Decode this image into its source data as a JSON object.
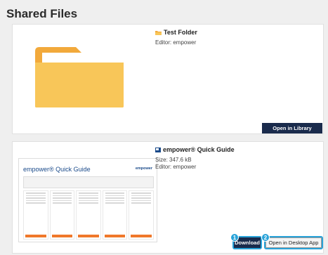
{
  "page": {
    "title": "Shared Files"
  },
  "items": [
    {
      "icon": "folder-icon",
      "name": "Test Folder",
      "editor": "Editor: empower",
      "button": "Open in Library"
    },
    {
      "icon": "presentation-icon",
      "name": "empower® Quick Guide",
      "size": "Size: 347.6 kB",
      "editor": "Editor: empower",
      "buttons": {
        "download": "Download",
        "open_desktop": "Open in Desktop App"
      },
      "badges": {
        "download": "1",
        "open_desktop": "2"
      }
    }
  ],
  "guide_thumbnail": {
    "title": "empower® Quick Guide",
    "logo": "empower"
  },
  "colors": {
    "accent": "#29a3d9",
    "dark_button": "#1a2b4c",
    "folder": "#f7c04a"
  }
}
